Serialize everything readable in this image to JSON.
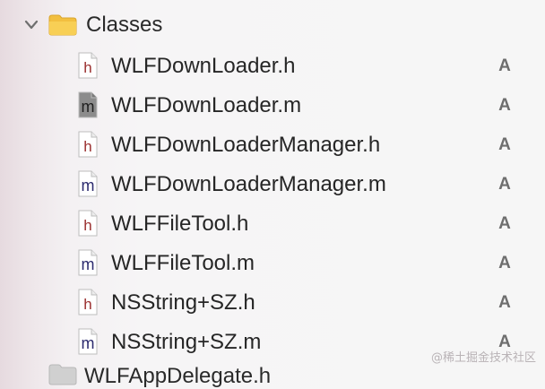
{
  "navigator": {
    "group": {
      "label": "Classes",
      "icon": "folder-icon",
      "expanded": true
    },
    "files": [
      {
        "name": "WLFDownLoader.h",
        "type": "h",
        "icon": "header-file-icon",
        "status": "A",
        "selected": false
      },
      {
        "name": "WLFDownLoader.m",
        "type": "m",
        "icon": "implementation-file-icon",
        "status": "A",
        "selected": true
      },
      {
        "name": "WLFDownLoaderManager.h",
        "type": "h",
        "icon": "header-file-icon",
        "status": "A",
        "selected": false
      },
      {
        "name": "WLFDownLoaderManager.m",
        "type": "m",
        "icon": "implementation-file-icon",
        "status": "A",
        "selected": false
      },
      {
        "name": "WLFFileTool.h",
        "type": "h",
        "icon": "header-file-icon",
        "status": "A",
        "selected": false
      },
      {
        "name": "WLFFileTool.m",
        "type": "m",
        "icon": "implementation-file-icon",
        "status": "A",
        "selected": false
      },
      {
        "name": "NSString+SZ.h",
        "type": "h",
        "icon": "header-file-icon",
        "status": "A",
        "selected": false
      },
      {
        "name": "NSString+SZ.m",
        "type": "m",
        "icon": "implementation-file-icon",
        "status": "A",
        "selected": false
      }
    ],
    "next_item": {
      "label": "WLFAppDelegate.h",
      "icon": "folder-icon"
    }
  },
  "watermark": "@稀土掘金技术社区",
  "colors": {
    "folder": "#f5c542",
    "header_letter": "#9a2f2f",
    "impl_letter": "#2b2a6e",
    "status_text": "#6e6e6e",
    "selected_icon_fill": "#8c8c8c"
  }
}
